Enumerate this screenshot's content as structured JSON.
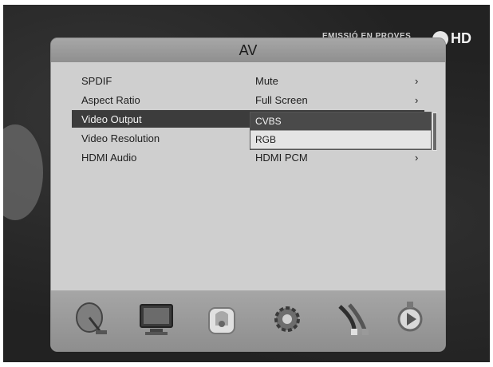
{
  "background": {
    "channel_text": "EMISSIÓ EN PROVES",
    "hd_label": "HD"
  },
  "panel": {
    "title": "AV",
    "rows": [
      {
        "label": "SPDIF",
        "value": "Mute",
        "arrow": "›"
      },
      {
        "label": "Aspect Ratio",
        "value": "Full Screen",
        "arrow": "›"
      },
      {
        "label": "Video Output",
        "value": "",
        "arrow": ""
      },
      {
        "label": "Video Resolution",
        "value": "",
        "arrow": ""
      },
      {
        "label": "HDMI Audio",
        "value": "HDMI PCM",
        "arrow": "›"
      }
    ],
    "dropdown": {
      "options": [
        "CVBS",
        "RGB"
      ],
      "selected": "CVBS"
    }
  },
  "iconbar": {
    "icons": [
      "satellite-dish-icon",
      "tv-monitor-icon",
      "parental-lock-icon",
      "settings-gear-icon",
      "av-cables-icon",
      "media-player-icon"
    ]
  },
  "colors": {
    "panel": "#cfcfcf",
    "highlight": "#3c3c3c",
    "header": "#999999"
  }
}
